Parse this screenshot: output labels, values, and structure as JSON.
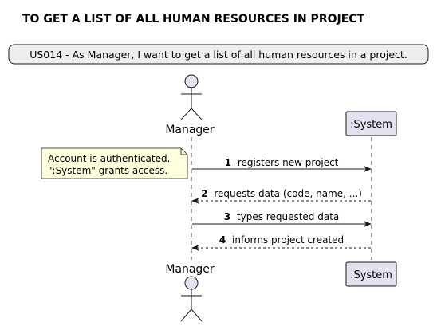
{
  "diagram": {
    "title": "TO GET A LIST OF ALL HUMAN RESOURCES IN PROJECT",
    "banner": "US014 - As Manager, I want to get a list of all human resources in a project.",
    "actor": {
      "name": "Manager",
      "icon": "stick-figure-icon"
    },
    "system": {
      "name": ":System"
    },
    "note": {
      "lines": [
        "Account is authenticated.",
        "\":System\" grants access."
      ]
    },
    "messages": [
      {
        "number": "1",
        "text": "registers new project",
        "direction": "actor-to-system",
        "style": "solid"
      },
      {
        "number": "2",
        "text": "requests data (code, name, ...)",
        "direction": "system-to-actor",
        "style": "dashed"
      },
      {
        "number": "3",
        "text": "types requested data",
        "direction": "actor-to-system",
        "style": "solid"
      },
      {
        "number": "4",
        "text": "informs project created",
        "direction": "system-to-actor",
        "style": "dashed"
      }
    ]
  },
  "colors": {
    "participant_fill": "#E2E2F0",
    "participant_stroke": "#181818",
    "note_fill": "#FEFFDD",
    "banner_fill": "#EEEEEE",
    "line": "#181818"
  }
}
